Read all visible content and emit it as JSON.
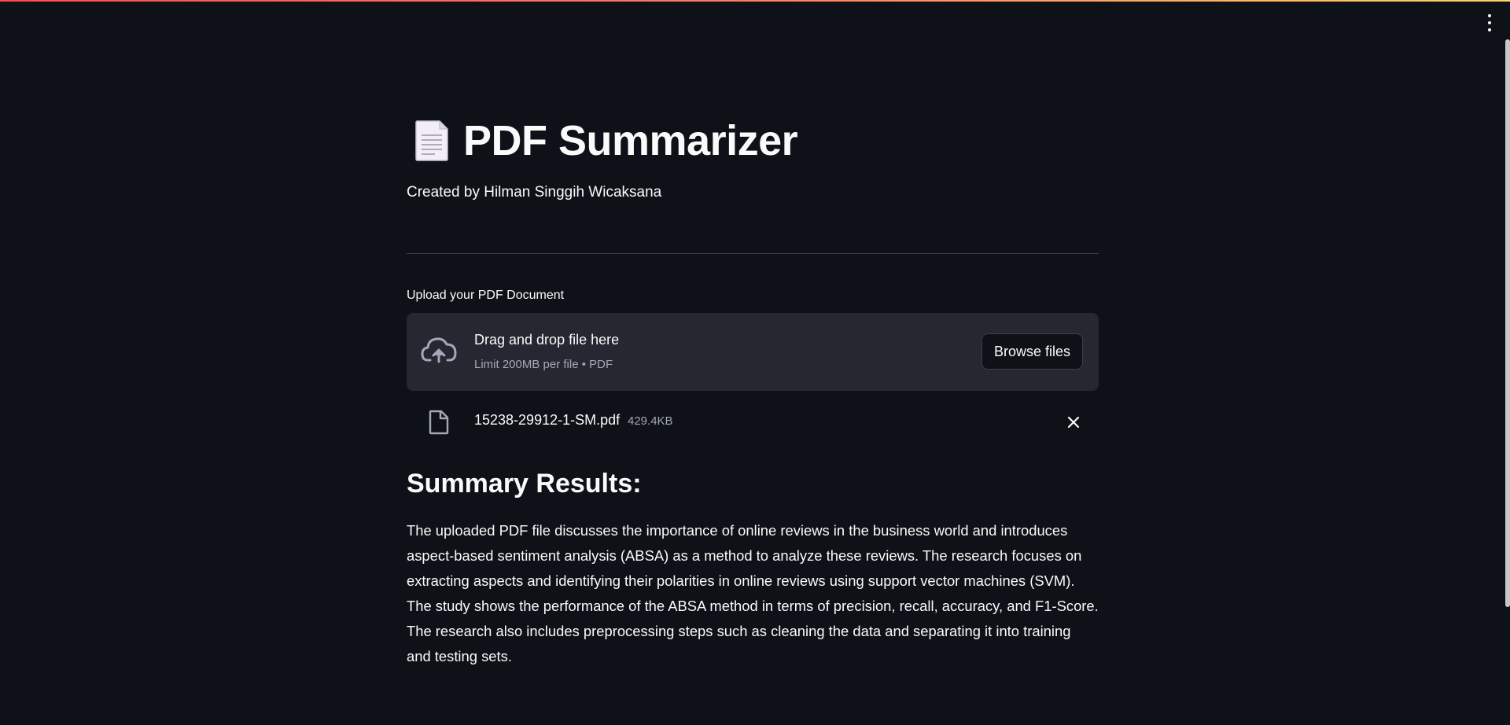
{
  "app": {
    "title": "PDF Summarizer",
    "credits": "Created by Hilman Singgih Wicaksana"
  },
  "uploader": {
    "label": "Upload your PDF Document",
    "drop_text": "Drag and drop file here",
    "limit_text": "Limit 200MB per file • PDF",
    "browse_label": "Browse files"
  },
  "uploaded_file": {
    "name": "15238-29912-1-SM.pdf",
    "size": "429.4KB"
  },
  "summary": {
    "heading": "Summary Results:",
    "text": "The uploaded PDF file discusses the importance of online reviews in the business world and introduces aspect-based sentiment analysis (ABSA) as a method to analyze these reviews. The research focuses on extracting aspects and identifying their polarities in online reviews using support vector machines (SVM). The study shows the performance of the ABSA method in terms of precision, recall, accuracy, and F1-Score. The research also includes preprocessing steps such as cleaning the data and separating it into training and testing sets."
  },
  "icons": {
    "title": "page-facing-up-icon",
    "menu": "kebab-menu-icon",
    "upload": "cloud-upload-icon",
    "file": "file-icon",
    "remove": "close-icon"
  },
  "colors": {
    "background": "#0e1117",
    "dropzone": "#262730",
    "text": "#fafafa",
    "muted": "#a3a8b8",
    "accent": "#ff4b4b"
  }
}
